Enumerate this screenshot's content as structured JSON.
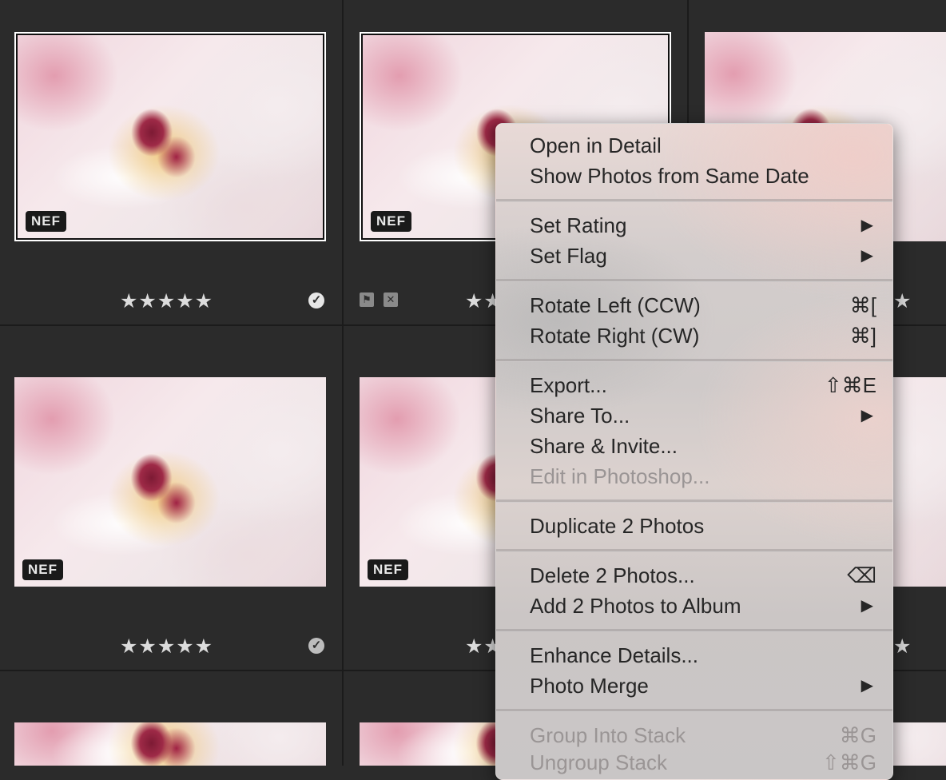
{
  "grid": {
    "badge_label": "NEF",
    "rating_stars": "★★★★★",
    "partial_stars": "★★",
    "edge_star": "★",
    "check_glyph": "✓",
    "flag_pick_glyph": "⚑",
    "flag_reject_glyph": "✕"
  },
  "menu": {
    "items": [
      {
        "label": "Open in Detail"
      },
      {
        "label": "Show Photos from Same Date"
      },
      {
        "label": "Set Rating",
        "arrow": "▶"
      },
      {
        "label": "Set Flag",
        "arrow": "▶"
      },
      {
        "label": "Rotate Left (CCW)",
        "shortcut": "⌘["
      },
      {
        "label": "Rotate Right (CW)",
        "shortcut": "⌘]"
      },
      {
        "label": "Export...",
        "shortcut": "⇧⌘E"
      },
      {
        "label": "Share To...",
        "arrow": "▶"
      },
      {
        "label": "Share & Invite..."
      },
      {
        "label": "Edit in Photoshop..."
      },
      {
        "label": "Duplicate 2 Photos"
      },
      {
        "label": "Delete 2 Photos...",
        "shortcut": "⌫"
      },
      {
        "label": "Add 2 Photos to Album",
        "arrow": "▶"
      },
      {
        "label": "Enhance Details..."
      },
      {
        "label": "Photo Merge",
        "arrow": "▶"
      },
      {
        "label": "Group Into Stack",
        "shortcut": "⌘G"
      },
      {
        "label": "Ungroup Stack",
        "shortcut": "⇧⌘G"
      }
    ]
  }
}
